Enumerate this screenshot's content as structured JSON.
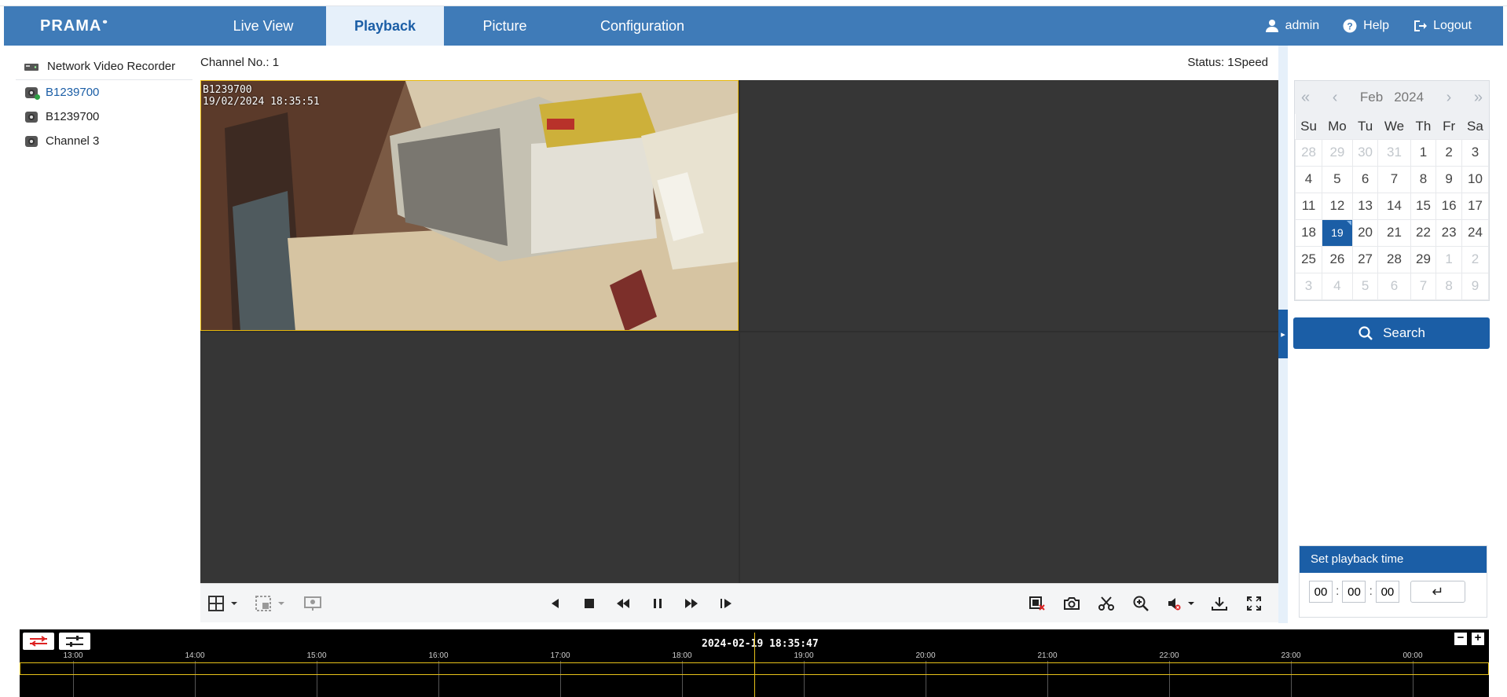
{
  "brand": {
    "logo": "PRAMA"
  },
  "nav": {
    "tabs": [
      {
        "label": "Live View"
      },
      {
        "label": "Playback"
      },
      {
        "label": "Picture"
      },
      {
        "label": "Configuration"
      }
    ],
    "active": "Playback"
  },
  "user": {
    "name": "admin",
    "help": "Help",
    "logout": "Logout"
  },
  "tree": {
    "root": "Network Video Recorder",
    "items": [
      {
        "label": "B1239700"
      },
      {
        "label": "B1239700"
      },
      {
        "label": "Channel 3"
      }
    ]
  },
  "player": {
    "channel_label": "Channel No.: 1",
    "status_label": "Status: 1Speed",
    "osd_name": "B1239700",
    "osd_time": "19/02/2024 18:35:51"
  },
  "calendar": {
    "month": "Feb",
    "year": "2024",
    "weekdays": [
      "Su",
      "Mo",
      "Tu",
      "We",
      "Th",
      "Fr",
      "Sa"
    ],
    "weeks": [
      [
        "28",
        "29",
        "30",
        "31",
        "1",
        "2",
        "3"
      ],
      [
        "4",
        "5",
        "6",
        "7",
        "8",
        "9",
        "10"
      ],
      [
        "11",
        "12",
        "13",
        "14",
        "15",
        "16",
        "17"
      ],
      [
        "18",
        "19",
        "20",
        "21",
        "22",
        "23",
        "24"
      ],
      [
        "25",
        "26",
        "27",
        "28",
        "29",
        "1",
        "2"
      ],
      [
        "3",
        "4",
        "5",
        "6",
        "7",
        "8",
        "9"
      ]
    ],
    "selected": "19"
  },
  "search": {
    "label": "Search"
  },
  "playback_time": {
    "title": "Set playback time",
    "hh": "00",
    "mm": "00",
    "ss": "00"
  },
  "timeline": {
    "current": "2024-02-19 18:35:47",
    "hours": [
      "13:00",
      "14:00",
      "15:00",
      "16:00",
      "17:00",
      "18:00",
      "19:00",
      "20:00",
      "21:00",
      "22:00",
      "23:00",
      "00:00"
    ],
    "accent": "#e7c21a"
  },
  "colors": {
    "header": "#3f7bb8",
    "accent": "#1b5ea6"
  }
}
